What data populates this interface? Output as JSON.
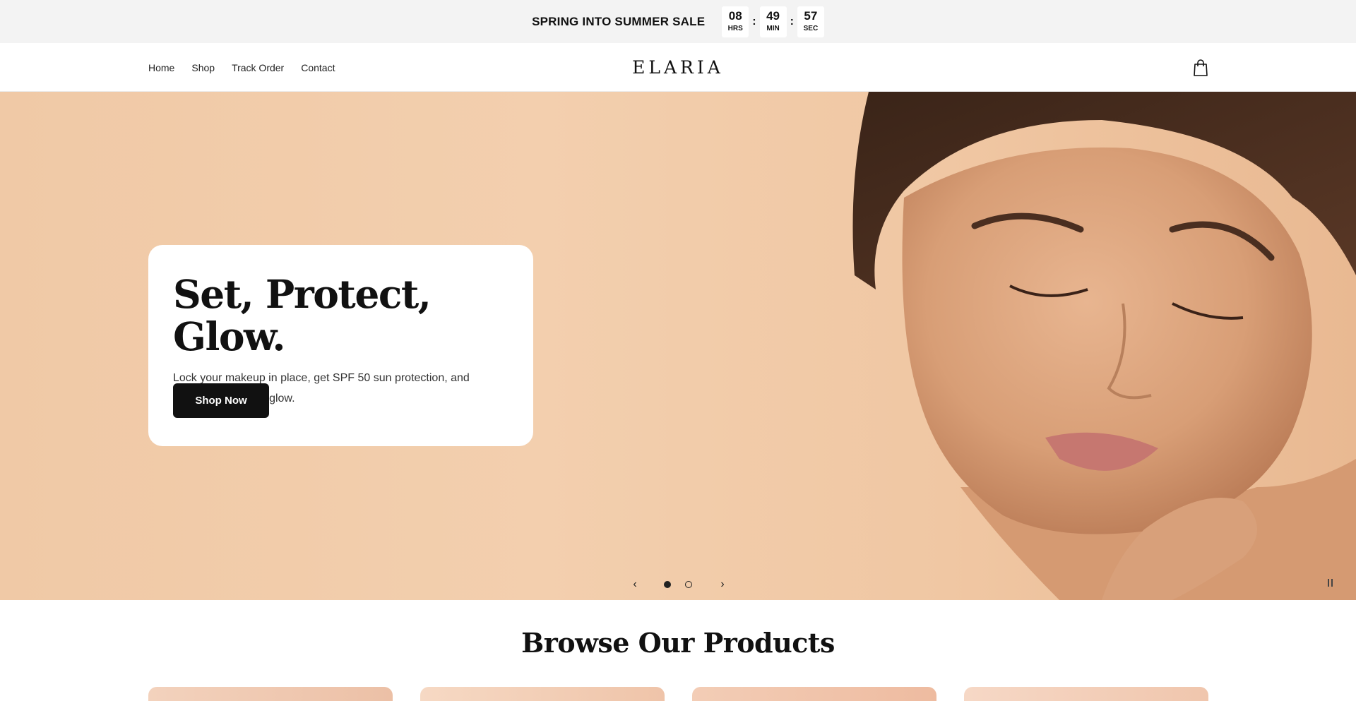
{
  "announcement": {
    "text": "SPRING INTO SUMMER SALE",
    "countdown": [
      {
        "value": "08",
        "label": "HRS"
      },
      {
        "value": "49",
        "label": "MIN"
      },
      {
        "value": "57",
        "label": "SEC"
      }
    ],
    "separator": ":"
  },
  "header": {
    "nav": [
      "Home",
      "Shop",
      "Track Order",
      "Contact"
    ],
    "logo": "ELARIA",
    "cart_icon": "shopping-bag-icon"
  },
  "hero": {
    "title": "Set, Protect, Glow.",
    "subtitle": "Lock your makeup in place, get SPF 50 sun protection, and hydrate for a dewy glow.",
    "cta": "Shop Now",
    "slide_count": 2,
    "active_slide": 1,
    "prev_icon": "chevron-left-icon",
    "next_icon": "chevron-right-icon",
    "pause_icon": "pause-icon"
  },
  "browse": {
    "title": "Browse Our Products"
  },
  "colors": {
    "accent": "#111111",
    "announce_bg": "#f3f3f3",
    "hero_bg": "#f0c9a6"
  }
}
